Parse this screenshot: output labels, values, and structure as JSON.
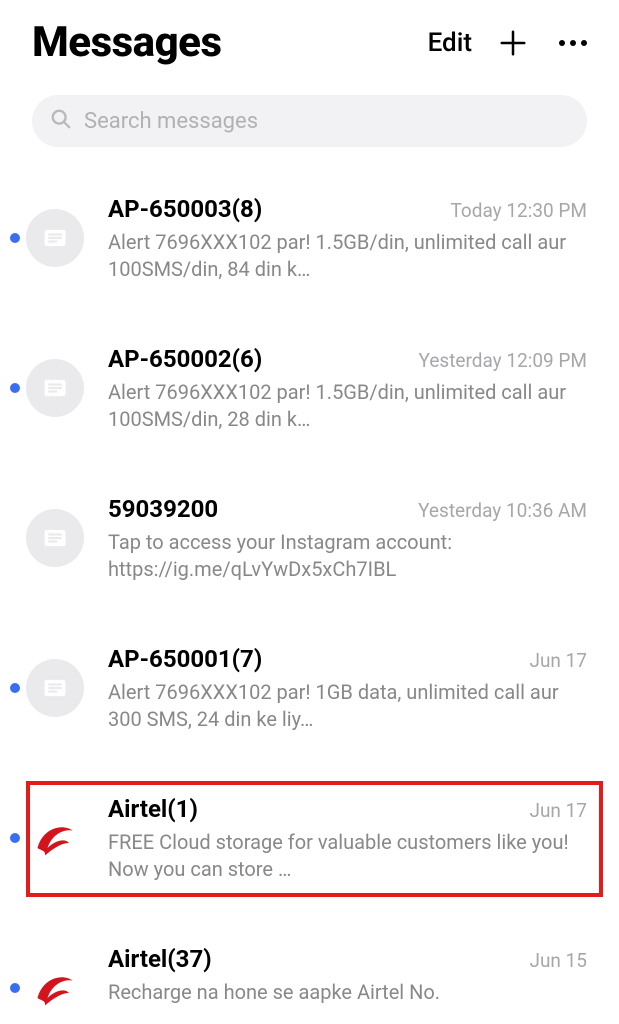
{
  "header": {
    "title": "Messages",
    "edit": "Edit"
  },
  "search": {
    "placeholder": "Search messages"
  },
  "conversations": [
    {
      "sender": "AP-650003(8)",
      "time": "Today 12:30 PM",
      "preview": "Alert 7696XXX102 par! 1.5GB/din, unlimited call aur 100SMS/din, 84 din k…",
      "unread": true,
      "avatar": "generic",
      "highlighted": false
    },
    {
      "sender": "AP-650002(6)",
      "time": "Yesterday 12:09 PM",
      "preview": "Alert 7696XXX102 par! 1.5GB/din, unlimited call aur 100SMS/din, 28 din k…",
      "unread": true,
      "avatar": "generic",
      "highlighted": false
    },
    {
      "sender": "59039200",
      "time": "Yesterday 10:36 AM",
      "preview": "Tap to access your Instagram account: https://ig.me/qLvYwDx5xCh7IBL",
      "unread": false,
      "avatar": "generic",
      "highlighted": false
    },
    {
      "sender": "AP-650001(7)",
      "time": "Jun 17",
      "preview": "Alert 7696XXX102 par!  1GB data, unlimited call aur 300 SMS, 24 din ke liy…",
      "unread": true,
      "avatar": "generic",
      "highlighted": false
    },
    {
      "sender": "Airtel(1)",
      "time": "Jun 17",
      "preview": "FREE Cloud storage for valuable customers like you! Now you can store …",
      "unread": true,
      "avatar": "airtel",
      "highlighted": true
    },
    {
      "sender": "Airtel(37)",
      "time": "Jun 15",
      "preview": "Recharge na hone se aapke Airtel No.",
      "unread": true,
      "avatar": "airtel",
      "highlighted": false
    }
  ]
}
